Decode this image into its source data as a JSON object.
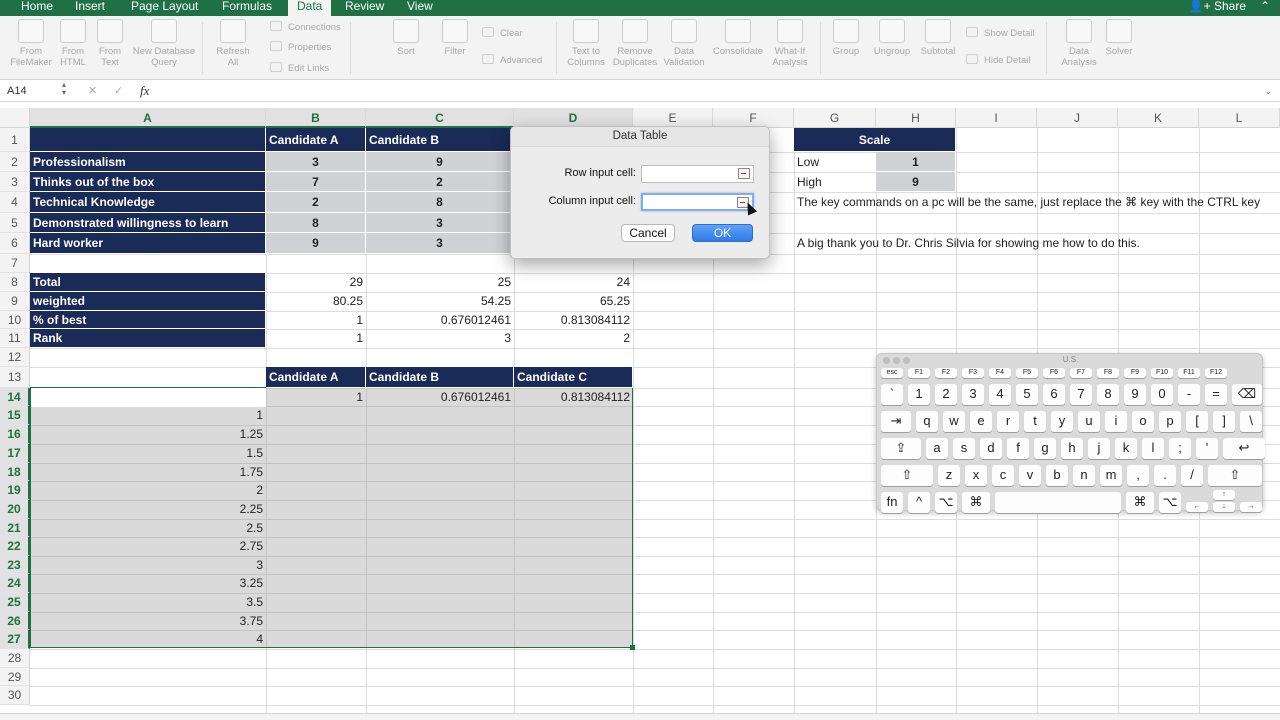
{
  "ribbon_tabs": [
    "Home",
    "Insert",
    "Page Layout",
    "Formulas",
    "Data",
    "Review",
    "View"
  ],
  "active_tab": "Data",
  "share_label": "Share",
  "ribbon": {
    "from_filemaker": "From\nFileMaker",
    "from_html": "From\nHTML",
    "from_text": "From\nText",
    "new_db_query": "New Database\nQuery",
    "refresh_all": "Refresh\nAll",
    "connections": "Connections",
    "properties": "Properties",
    "edit_links": "Edit Links",
    "sort": "Sort",
    "filter": "Filter",
    "clear": "Clear",
    "advanced": "Advanced",
    "text_to_columns": "Text to\nColumns",
    "remove_duplicates": "Remove\nDuplicates",
    "data_validation": "Data\nValidation",
    "consolidate": "Consolidate",
    "what_if": "What-If\nAnalysis",
    "group": "Group",
    "ungroup": "Ungroup",
    "subtotal": "Subtotal",
    "show_detail": "Show Detail",
    "hide_detail": "Hide Detail",
    "data_analysis": "Data\nAnalysis",
    "solver": "Solver"
  },
  "formula_bar": {
    "name_box": "A14",
    "fx": "fx",
    "formula": ""
  },
  "columns": [
    "A",
    "B",
    "C",
    "D",
    "E",
    "F",
    "G",
    "H",
    "I",
    "J",
    "K",
    "L"
  ],
  "rows": [
    "1",
    "2",
    "3",
    "4",
    "5",
    "6",
    "7",
    "8",
    "9",
    "10",
    "11",
    "12",
    "13",
    "14",
    "15",
    "16",
    "17",
    "18",
    "19",
    "20",
    "21",
    "22",
    "23",
    "24",
    "25",
    "26",
    "27",
    "28",
    "29",
    "30"
  ],
  "table1": {
    "header_b": "Candidate A",
    "header_c": "Candidate B",
    "criteria": [
      {
        "label": "Professionalism",
        "b": "3",
        "c": "9"
      },
      {
        "label": "Thinks out of the box",
        "b": "7",
        "c": "2"
      },
      {
        "label": "Technical Knowledge",
        "b": "2",
        "c": "8"
      },
      {
        "label": "Demonstrated willingness to learn",
        "b": "8",
        "c": "3"
      },
      {
        "label": "Hard worker",
        "b": "9",
        "c": "3"
      }
    ]
  },
  "summary": [
    {
      "label": "Total",
      "b": "29",
      "c": "25",
      "d": "24"
    },
    {
      "label": "weighted",
      "b": "80.25",
      "c": "54.25",
      "d": "65.25"
    },
    {
      "label": "% of best",
      "b": "1",
      "c": "0.676012461",
      "d": "0.813084112"
    },
    {
      "label": "Rank",
      "b": "1",
      "c": "3",
      "d": "2"
    }
  ],
  "table2": {
    "headers": [
      "Candidate A",
      "Candidate B",
      "Candidate C"
    ],
    "row14": [
      "1",
      "0.676012461",
      "0.813084112"
    ],
    "a_values": [
      "1",
      "1.25",
      "1.5",
      "1.75",
      "2",
      "2.25",
      "2.5",
      "2.75",
      "3",
      "3.25",
      "3.5",
      "3.75",
      "4"
    ]
  },
  "scale": {
    "title": "Scale",
    "low_label": "Low",
    "low_value": "1",
    "high_label": "High",
    "high_value": "9"
  },
  "notes": {
    "line1": "The key commands on a pc will be the same, just replace the ⌘ key with the CTRL key",
    "line2": "A big thank you to Dr. Chris Silvia for showing me how to do this."
  },
  "dialog": {
    "title": "Data Table",
    "row_input_label": "Row input cell:",
    "col_input_label": "Column input cell:",
    "row_input_value": "",
    "col_input_value": "",
    "cancel": "Cancel",
    "ok": "OK"
  },
  "keyboard": {
    "title": "U.S.",
    "fn_row": [
      "esc",
      "F1",
      "F2",
      "F3",
      "F4",
      "F5",
      "F6",
      "F7",
      "F8",
      "F9",
      "F10",
      "F11",
      "F12"
    ],
    "num_row": [
      "`",
      "1",
      "2",
      "3",
      "4",
      "5",
      "6",
      "7",
      "8",
      "9",
      "0",
      "-",
      "=",
      "⌫"
    ],
    "q_row": [
      "⇥",
      "q",
      "w",
      "e",
      "r",
      "t",
      "y",
      "u",
      "i",
      "o",
      "p",
      "[",
      "]",
      "\\"
    ],
    "a_row": [
      "⇪",
      "a",
      "s",
      "d",
      "f",
      "g",
      "h",
      "j",
      "k",
      "l",
      ";",
      "'",
      "↩"
    ],
    "z_row": [
      "⇧",
      "z",
      "x",
      "c",
      "v",
      "b",
      "n",
      "m",
      ",",
      ".",
      "/",
      "⇧"
    ],
    "bottom_row": [
      "fn",
      "^",
      "⌥",
      "⌘",
      "",
      "⌘",
      "⌥"
    ],
    "arrows": [
      "↑",
      "←",
      "↓",
      "→"
    ]
  },
  "colors": {
    "excel_green": "#1f7145",
    "navy": "#1a2b57",
    "gray_cell": "#d0d2d6",
    "ok_blue": "#2f7ae6"
  }
}
